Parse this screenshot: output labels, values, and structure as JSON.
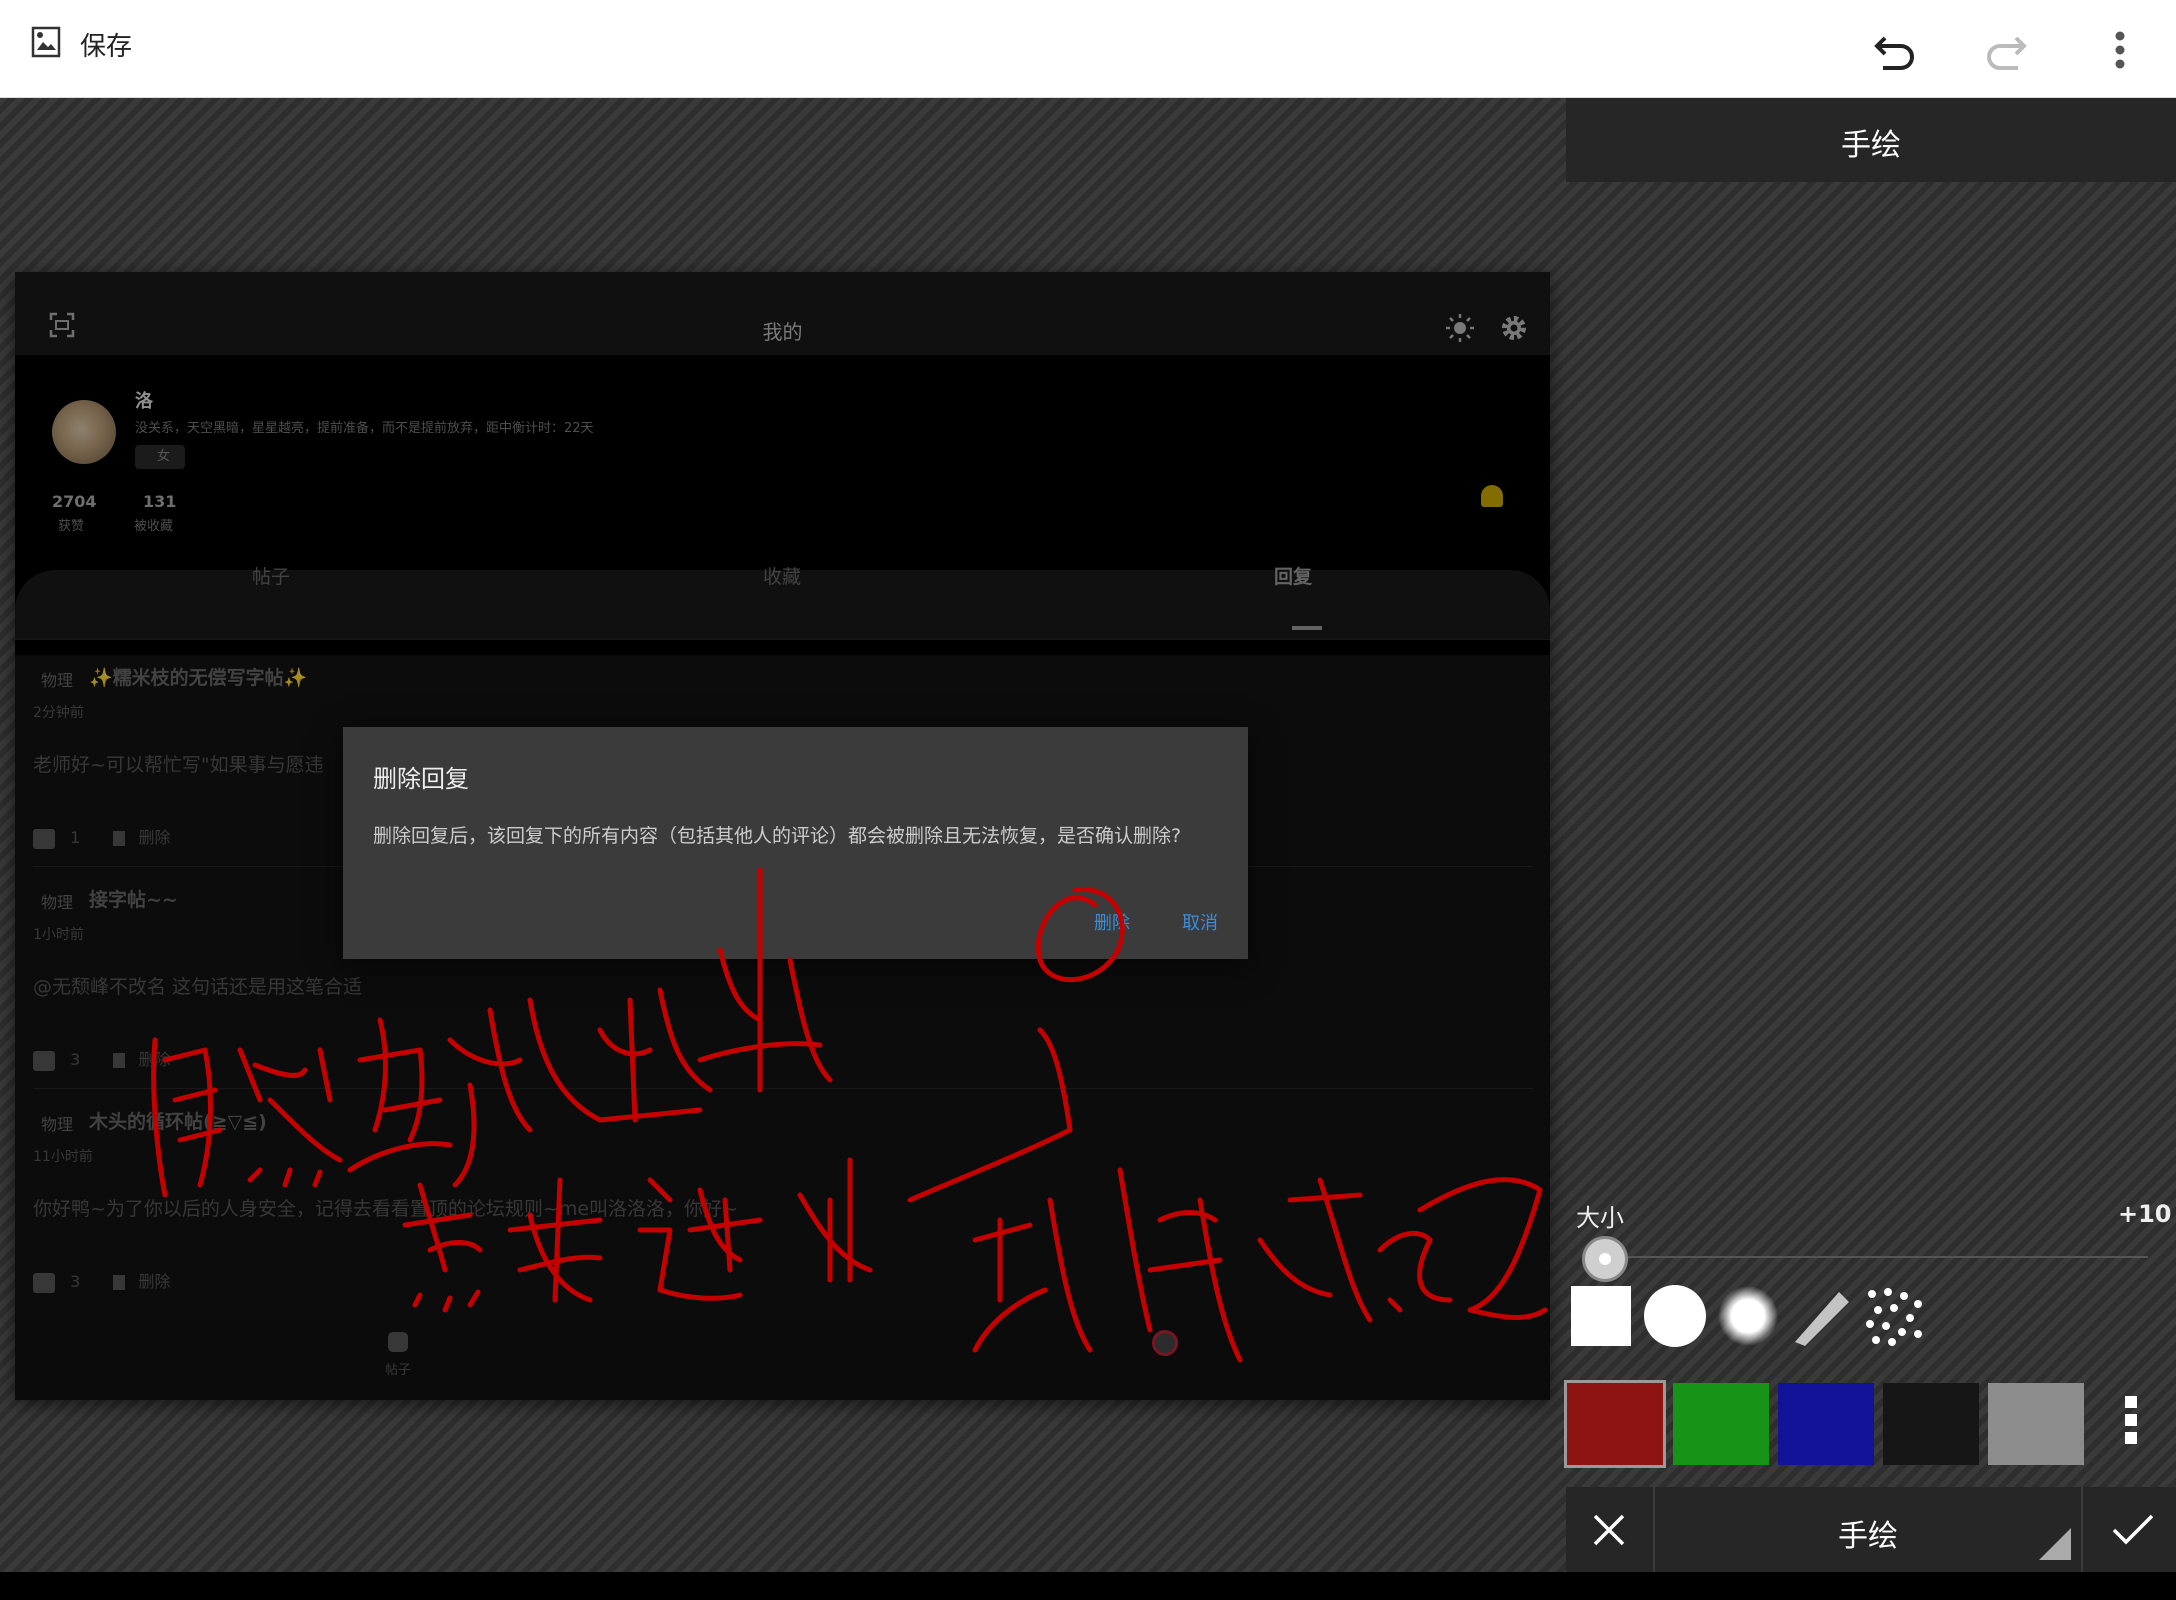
{
  "appbar": {
    "save_label": "保存",
    "icons": [
      "image-save-icon",
      "undo-icon",
      "redo-icon",
      "more-vert-icon"
    ]
  },
  "screenshot": {
    "page_title": "我的",
    "profile": {
      "name": "洛",
      "bio": "没关系，天空黑暗，星星越亮，提前准备，而不是提前放弃，距中衡计时：22天",
      "gender": "女",
      "stats": [
        {
          "value": "2704",
          "label": "获赞"
        },
        {
          "value": "131",
          "label": "被收藏"
        }
      ]
    },
    "tabs": [
      "帖子",
      "收藏",
      "回复"
    ],
    "active_tab": "回复",
    "posts": [
      {
        "tag": "物理",
        "title": "✨糯米枝的无偿写字帖✨",
        "time": "2分钟前",
        "body": "老师好~可以帮忙写\"如果事与愿违",
        "likes": "1",
        "delete": "删除"
      },
      {
        "tag": "物理",
        "title": "接字帖~~",
        "time": "1小时前",
        "body": "@无颓峰不改名 这句话还是用这笔合适",
        "likes": "3",
        "delete": "删除"
      },
      {
        "tag": "物理",
        "title": "木头的循环帖(≧▽≦)",
        "time": "11小时前",
        "body": "你好鸭~为了你以后的人身安全，记得去看看置顶的论坛规则~me叫洛洛洛，你好~",
        "likes": "3",
        "delete": "删除"
      }
    ],
    "bottom_nav": [
      "帖子"
    ],
    "dialog": {
      "title": "删除回复",
      "message": "删除回复后，该回复下的所有内容（包括其他人的评论）都会被删除且无法恢复，是否确认删除?",
      "confirm": "删除",
      "cancel": "取消"
    }
  },
  "panel": {
    "title": "手绘",
    "size_label": "大小",
    "size_value": "+10",
    "brushes": [
      "square-brush",
      "round-brush",
      "soft-brush",
      "marker-brush",
      "spray-brush"
    ],
    "colors": [
      "#8e1313",
      "#179417",
      "#13139a",
      "#161616",
      "#8d8d8d"
    ],
    "selected_color": "#8e1313",
    "mode_label": "手绘",
    "ink_color": "#c40000"
  }
}
